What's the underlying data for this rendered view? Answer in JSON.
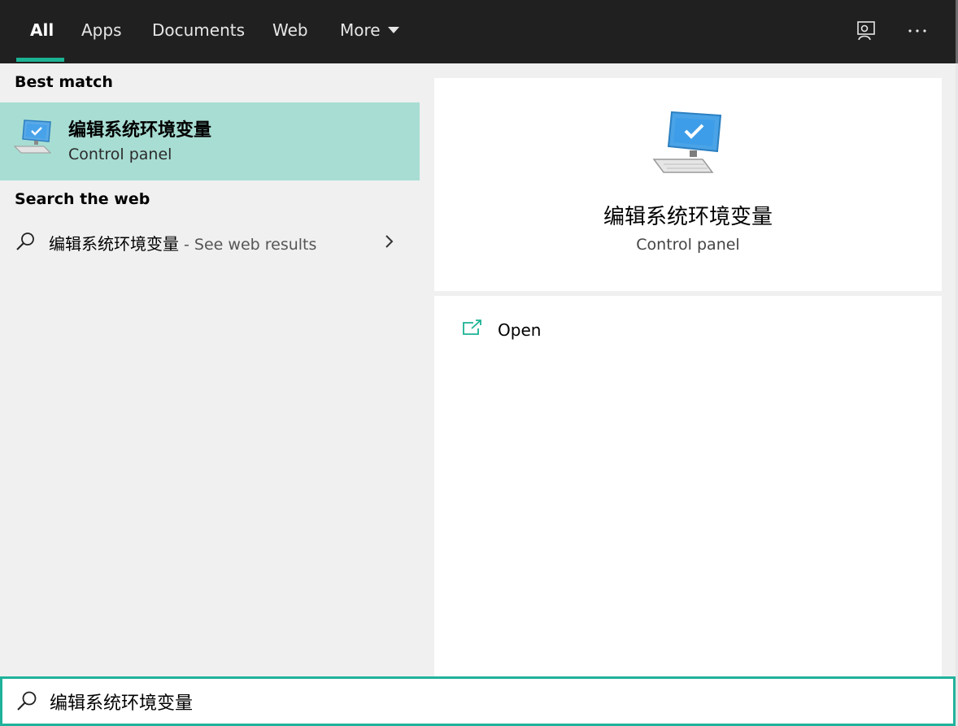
{
  "tabs": [
    {
      "label": "All",
      "active": true
    },
    {
      "label": "Apps"
    },
    {
      "label": "Documents"
    },
    {
      "label": "Web"
    },
    {
      "label": "More"
    }
  ],
  "topbar_icons": [
    "feedback-icon",
    "more-options-icon"
  ],
  "results": {
    "best_match_heading": "Best match",
    "best_match": {
      "title": "编辑系统环境变量",
      "subtitle": "Control panel",
      "icon": "computer-monitor-check-icon"
    },
    "web_heading": "Search the web",
    "web_result": {
      "query": "编辑系统环境变量",
      "hint": " - See web results"
    }
  },
  "preview": {
    "title": "编辑系统环境变量",
    "subtitle": "Control panel",
    "actions": [
      {
        "label": "Open",
        "icon": "open-external-icon"
      }
    ]
  },
  "search": {
    "value": "编辑系统环境变量"
  },
  "colors": {
    "accent": "#1bb393",
    "selection": "#a8ddd3",
    "topbar": "#202020"
  }
}
